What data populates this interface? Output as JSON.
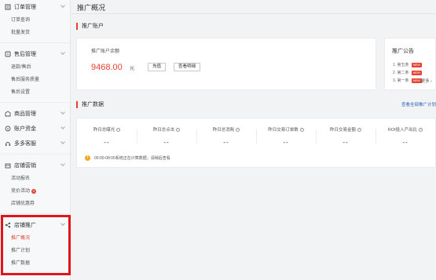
{
  "sidebar": {
    "groups": [
      {
        "label": "订单管理",
        "icon": "orders-icon",
        "items": [
          "订单查询",
          "批量发货"
        ]
      },
      {
        "label": "售后管理",
        "icon": "aftersale-icon",
        "items": [
          "退款/售后",
          "售后服务质量",
          "售后设置"
        ]
      },
      {
        "label": "商品管理",
        "icon": "goods-icon",
        "items": []
      },
      {
        "label": "账户资金",
        "icon": "wallet-icon",
        "items": []
      },
      {
        "label": "多多客服",
        "icon": "headset-icon",
        "items": []
      },
      {
        "label": "店铺营销",
        "icon": "marketing-icon",
        "items": [
          "活动报名",
          "竞价活动",
          "店铺优惠券"
        ],
        "badge": "9"
      },
      {
        "label": "店铺推广",
        "icon": "share-icon",
        "items": [
          "推广概况",
          "推广计划",
          "推广数据"
        ],
        "active_item": "推广概况"
      }
    ],
    "highlight_color": "#e0141a"
  },
  "page": {
    "title": "推广概况"
  },
  "account": {
    "section_title": "推广账户",
    "balance_label": "推广账户余额",
    "balance": "9468.00",
    "currency": "元",
    "recharge_btn": "充值",
    "detail_btn": "查看明细"
  },
  "notice": {
    "title": "推广公告",
    "items": [
      "1. 第五条",
      "2. 第二条",
      "3. 第一条"
    ],
    "new_tag": "NEW",
    "more": "更多"
  },
  "data_section": {
    "title": "推广数据",
    "view_all_link": "查看全部推广计划",
    "stats": [
      {
        "label": "昨日总曝光",
        "value": "--"
      },
      {
        "label": "昨日总点击",
        "value": "--"
      },
      {
        "label": "昨日总消耗",
        "value": "--"
      },
      {
        "label": "昨日交易订单数",
        "value": "--"
      },
      {
        "label": "昨日交易金额",
        "value": "--"
      },
      {
        "label": "ROI投入产出比",
        "value": "--"
      }
    ],
    "notice_text": "00:00-08:00系统正在计算数据，请稍后查看"
  },
  "colors": {
    "accent": "#e8412f",
    "link": "#2b64b8",
    "warning": "#f5a623"
  }
}
